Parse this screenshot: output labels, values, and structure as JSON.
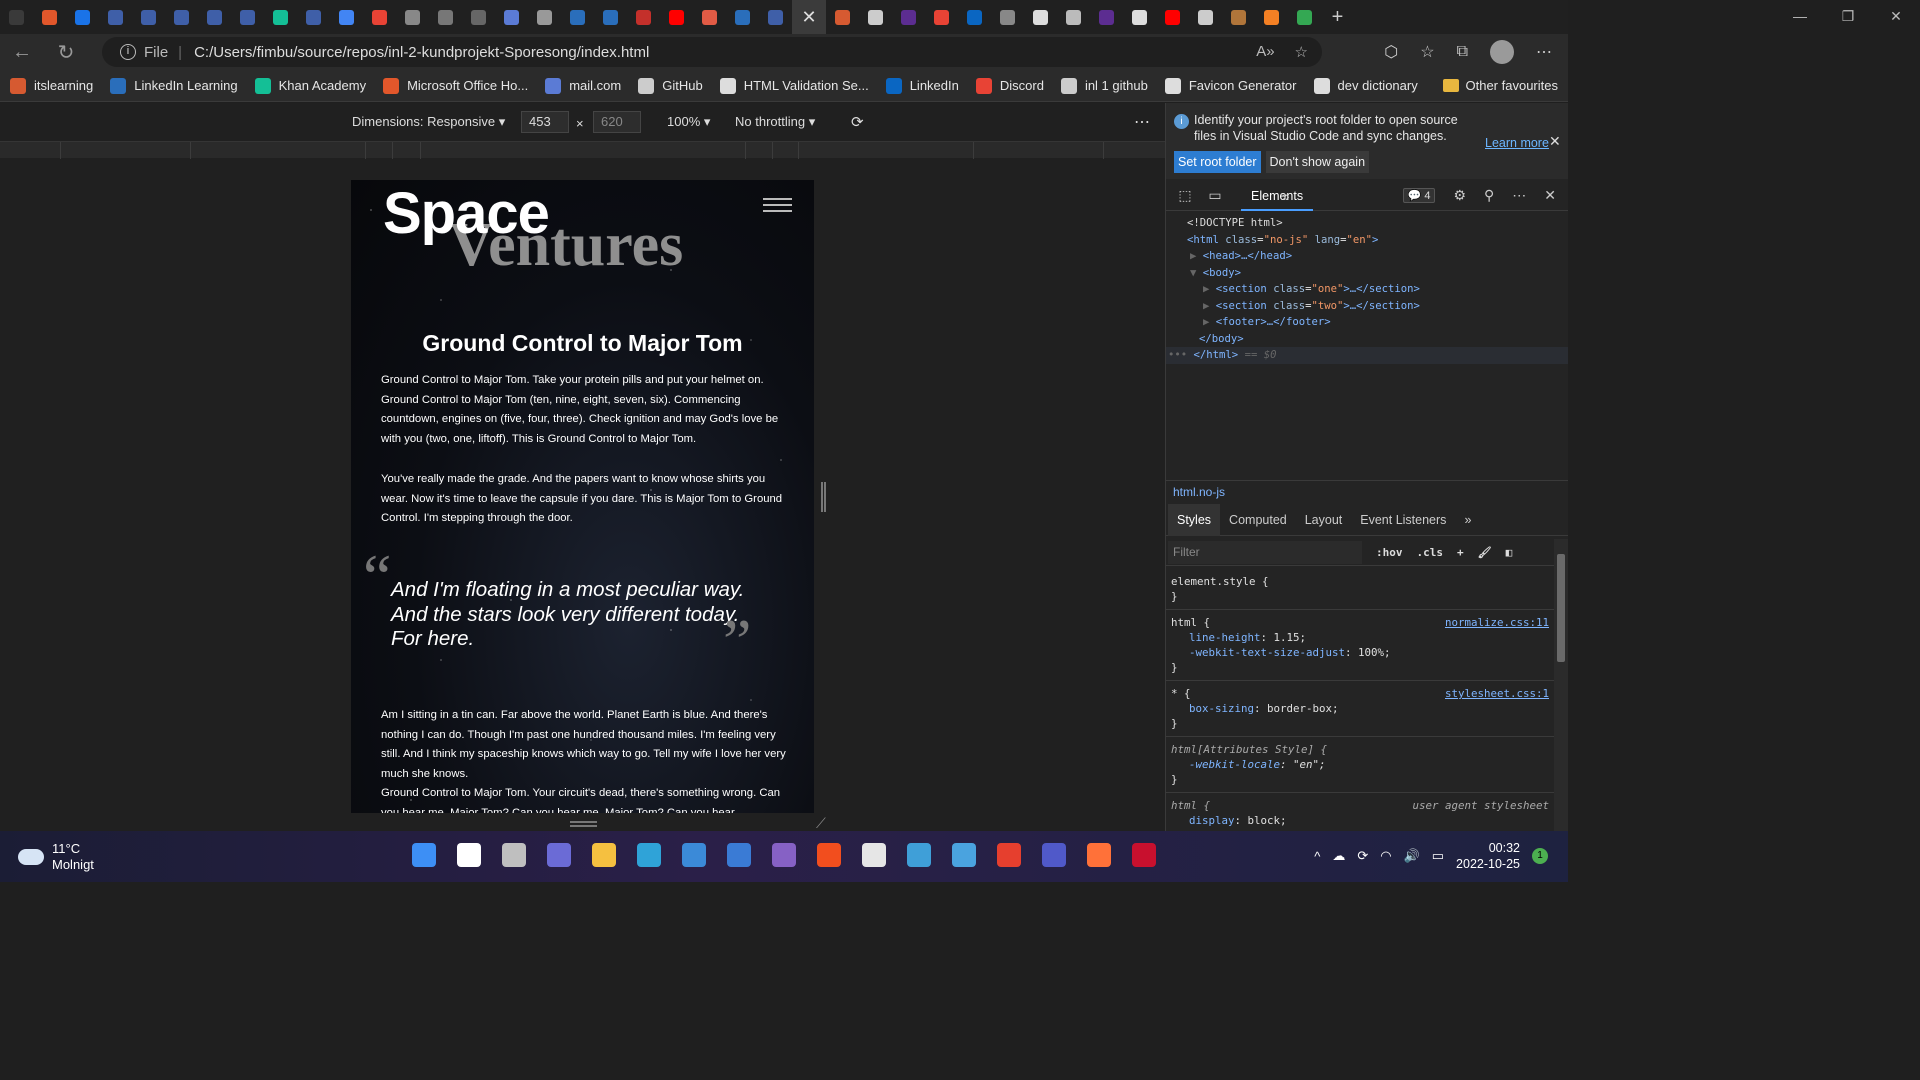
{
  "browser": {
    "tabs": [
      {
        "icon": "tab-actions-icon",
        "color": "#3a3a3a"
      },
      {
        "icon": "office-icon",
        "color": "#e2572b"
      },
      {
        "icon": "outlook-icon",
        "color": "#1a73e8"
      },
      {
        "icon": "video-icon",
        "color": "#3f5fa8"
      },
      {
        "icon": "video-icon",
        "color": "#3f5fa8"
      },
      {
        "icon": "video-icon",
        "color": "#3f5fa8"
      },
      {
        "icon": "video-icon",
        "color": "#3f5fa8"
      },
      {
        "icon": "video-icon",
        "color": "#3f5fa8"
      },
      {
        "icon": "khan-icon",
        "color": "#14bf96"
      },
      {
        "icon": "video-icon",
        "color": "#3f5fa8"
      },
      {
        "icon": "docs-icon",
        "color": "#4285f4"
      },
      {
        "icon": "chrome-ext-icon",
        "color": "#e84335"
      },
      {
        "icon": "page-icon",
        "color": "#888888"
      },
      {
        "icon": "page-icon",
        "color": "#777777"
      },
      {
        "icon": "star-icon",
        "color": "#666666"
      },
      {
        "icon": "mail-icon",
        "color": "#5b7bd5"
      },
      {
        "icon": "grammar-icon",
        "color": "#999999"
      },
      {
        "icon": "linkedin-learning-icon",
        "color": "#2a6ebb"
      },
      {
        "icon": "linkedin-learning-icon",
        "color": "#2a6ebb"
      },
      {
        "icon": "youtube-icon",
        "color": "#c4302b"
      },
      {
        "icon": "youtube-icon",
        "color": "#ff0000"
      },
      {
        "icon": "asterisk-icon",
        "color": "#e25b45"
      },
      {
        "icon": "linkedin-learning-icon",
        "color": "#2a6ebb"
      },
      {
        "icon": "video-icon",
        "color": "#3f5fa8"
      }
    ],
    "tabs_after": [
      {
        "icon": "itslearning-icon",
        "color": "#d65a31"
      },
      {
        "icon": "github-icon",
        "color": "#cccccc"
      },
      {
        "icon": "vs-icon",
        "color": "#5c2d91"
      },
      {
        "icon": "maps-icon",
        "color": "#e84335"
      },
      {
        "icon": "linkedin-icon",
        "color": "#0a66c2"
      },
      {
        "icon": "page-icon",
        "color": "#888888"
      },
      {
        "icon": "zoom-icon",
        "color": "#dddddd"
      },
      {
        "icon": "page-icon",
        "color": "#bbbbbb"
      },
      {
        "icon": "vs-icon",
        "color": "#5c2d91"
      },
      {
        "icon": "export-icon",
        "color": "#dddddd"
      },
      {
        "icon": "youtube-icon",
        "color": "#ff0000"
      },
      {
        "icon": "github-icon",
        "color": "#cccccc"
      },
      {
        "icon": "r-icon",
        "color": "#b0753a"
      },
      {
        "icon": "stack-icon",
        "color": "#f48024"
      },
      {
        "icon": "chrome-icon",
        "color": "#34a853"
      }
    ],
    "address": {
      "label": "File",
      "url": "C:/Users/fimbu/source/repos/inl-2-kundprojekt-Sporesong/index.html"
    },
    "favourites": [
      {
        "label": "itslearning",
        "icon": "itslearning-icon",
        "color": "#d65a31"
      },
      {
        "label": "LinkedIn Learning",
        "icon": "linkedin-learning-icon",
        "color": "#2a6ebb"
      },
      {
        "label": "Khan Academy",
        "icon": "khan-icon",
        "color": "#14bf96"
      },
      {
        "label": "Microsoft Office Ho...",
        "icon": "office-icon",
        "color": "#e2572b"
      },
      {
        "label": "mail.com",
        "icon": "mail-icon",
        "color": "#5b7bd5"
      },
      {
        "label": "GitHub",
        "icon": "github-icon",
        "color": "#cccccc"
      },
      {
        "label": "HTML Validation Se...",
        "icon": "w3c-icon",
        "color": "#dddddd"
      },
      {
        "label": "LinkedIn",
        "icon": "linkedin-icon",
        "color": "#0a66c2"
      },
      {
        "label": "Discord",
        "icon": "discord-icon",
        "color": "#e84335"
      },
      {
        "label": "inl 1 github",
        "icon": "github-icon",
        "color": "#cccccc"
      },
      {
        "label": "Favicon Generator",
        "icon": "favicon-icon",
        "color": "#dddddd"
      },
      {
        "label": "dev dictionary",
        "icon": "dev-dictionary-icon",
        "color": "#dddddd"
      }
    ],
    "other_favourites": "Other favourites"
  },
  "device_toolbar": {
    "dimensions": "Dimensions: Responsive",
    "width": "453",
    "height": "620",
    "times": "×",
    "zoom": "100%",
    "throttling": "No throttling"
  },
  "page": {
    "logo_word1": "Space",
    "logo_word2": "Ventures",
    "heading": "Ground Control to Major Tom",
    "para1": "Ground Control to Major Tom. Take your protein pills and put your helmet on. Ground Control to Major Tom (ten, nine, eight, seven, six). Commencing countdown, engines on (five, four, three). Check ignition and may God's love be with you (two, one, liftoff). This is Ground Control to Major Tom.",
    "para2": "You've really made the grade. And the papers want to know whose shirts you wear. Now it's time to leave the capsule if you dare. This is Major Tom to Ground Control. I'm stepping through the door.",
    "quote": "And I'm floating in a most peculiar way. And the stars look very different today. For here.",
    "para3": "Am I sitting in a tin can. Far above the world. Planet Earth is blue. And there's nothing I can do. Though I'm past one hundred thousand miles. I'm feeling very still. And I think my spaceship knows which way to go. Tell my wife I love her very much she knows.",
    "para4": "Ground Control to Major Tom. Your circuit's dead, there's something wrong. Can you hear me, Major Tom? Can you hear me, Major Tom? Can you hear"
  },
  "devtools": {
    "notice_text": "Identify your project's root folder to open source files in Visual Studio Code and sync changes.",
    "learn_more": "Learn more",
    "set_root": "Set root folder",
    "dont_show": "Don't show again",
    "elements_tab": "Elements",
    "issues_count": "4",
    "dom": {
      "doctype": "<!DOCTYPE html>",
      "html_open_tag": "<html",
      "class_attr": "class",
      "class_val": "\"no-js\"",
      "lang_attr": "lang",
      "lang_val": "\"en\"",
      "head": "<head>…</head>",
      "body_open": "<body>",
      "section_tag": "<section",
      "section1_val": "\"one\"",
      "section2_val": "\"two\"",
      "section_close": ">…</section>",
      "footer": "<footer>…</footer>",
      "body_close": "</body>",
      "html_close": "</html>",
      "eq": "== $0"
    },
    "breadcrumb": "html.no-js",
    "styles_tabs": [
      "Styles",
      "Computed",
      "Layout",
      "Event Listeners"
    ],
    "filter_placeholder": "Filter",
    "hov": ":hov",
    "cls": ".cls",
    "rules": {
      "r1_selector": "element.style {",
      "r2_selector": "html {",
      "r2_source": "normalize.css:11",
      "r2_p1_name": "line-height",
      "r2_p1_val": "1.15;",
      "r2_p2_name": "-webkit-text-size-adjust",
      "r2_p2_val": "100%;",
      "r3_selector": "* {",
      "r3_source": "stylesheet.css:1",
      "r3_p1_name": "box-sizing",
      "r3_p1_val": "border-box;",
      "r4_selector": "html[Attributes Style] {",
      "r4_p1_name": "-webkit-locale",
      "r4_p1_val": "\"en\";",
      "r5_selector": "html {",
      "r5_source": "user agent stylesheet",
      "r5_p1_name": "display",
      "r5_p1_val": "block;",
      "close": "}"
    }
  },
  "taskbar": {
    "temp": "11°C",
    "condition": "Molnigt",
    "time": "00:32",
    "date": "2022-10-25",
    "notif": "1",
    "apps": [
      {
        "icon": "start-icon",
        "color": "#3d8ff5"
      },
      {
        "icon": "search-icon",
        "color": "#ffffff"
      },
      {
        "icon": "task-view-icon",
        "color": "#bfbfbf"
      },
      {
        "icon": "chat-icon",
        "color": "#6b6bd6"
      },
      {
        "icon": "file-explorer-icon",
        "color": "#f5c040"
      },
      {
        "icon": "edge-icon",
        "color": "#2fa3d8"
      },
      {
        "icon": "store-icon",
        "color": "#3b8ad8"
      },
      {
        "icon": "vscode-icon",
        "color": "#3a7bd5"
      },
      {
        "icon": "visual-studio-icon",
        "color": "#8661c5"
      },
      {
        "icon": "figma-icon",
        "color": "#f24e1e"
      },
      {
        "icon": "snipping-icon",
        "color": "#e6e6e6"
      },
      {
        "icon": "notepad-icon",
        "color": "#3f9fd8"
      },
      {
        "icon": "photos-icon",
        "color": "#4aa3df"
      },
      {
        "icon": "creative-cloud-icon",
        "color": "#e63f2e"
      },
      {
        "icon": "teams-icon",
        "color": "#5059c9"
      },
      {
        "icon": "firefox-icon",
        "color": "#ff7139"
      },
      {
        "icon": "mcafee-icon",
        "color": "#c8102e"
      }
    ]
  }
}
